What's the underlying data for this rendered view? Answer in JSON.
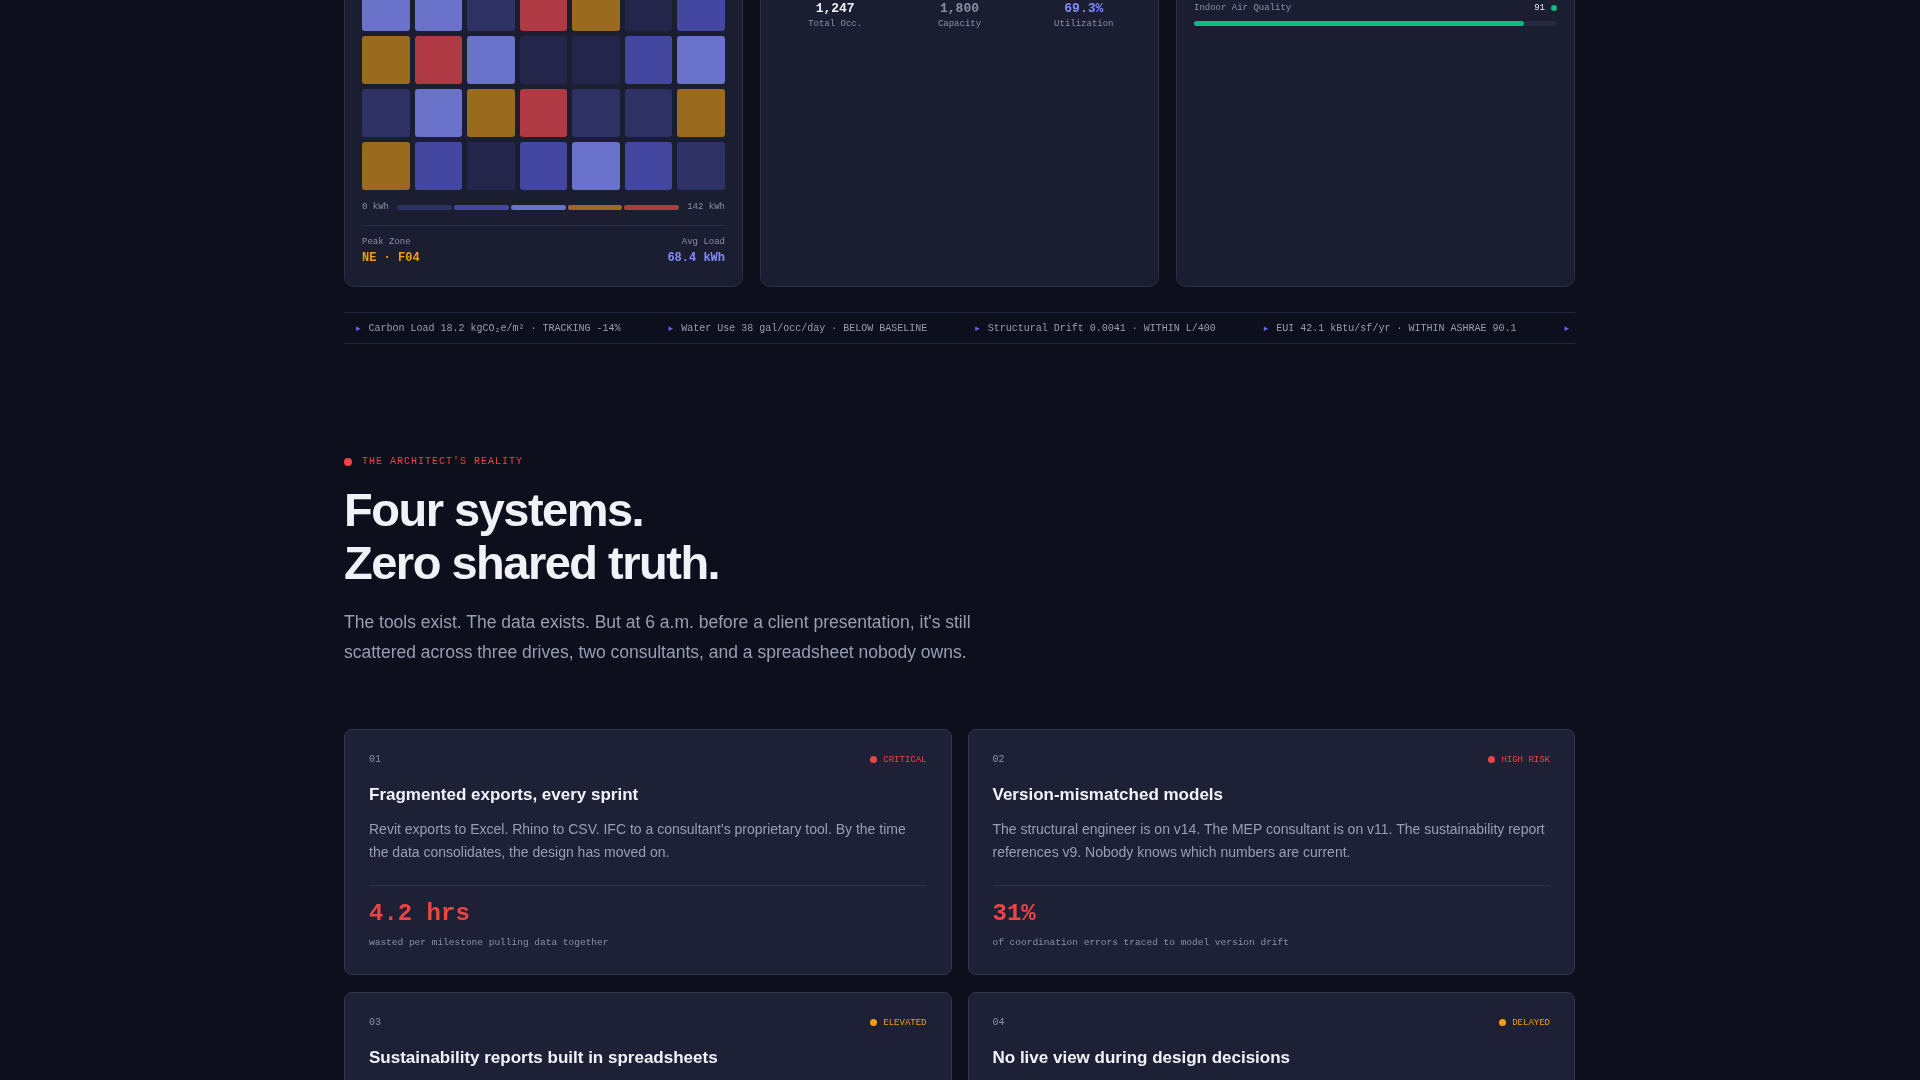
{
  "heatmap": {
    "cells": [
      {
        "color": "#6b72c9"
      },
      {
        "color": "#6b72c9"
      },
      {
        "color": "#2e3163"
      },
      {
        "color": "#b03a43"
      },
      {
        "color": "#9a6b1f"
      },
      {
        "color": "#23264a"
      },
      {
        "color": "#4347a0"
      },
      {
        "color": "#9a6b1f"
      },
      {
        "color": "#b03a43"
      },
      {
        "color": "#6b72c9"
      },
      {
        "color": "#23264a"
      },
      {
        "color": "#23264a"
      },
      {
        "color": "#4347a0"
      },
      {
        "color": "#6b72c9"
      },
      {
        "color": "#2e3163"
      },
      {
        "color": "#6b72c9"
      },
      {
        "color": "#9a6b1f"
      },
      {
        "color": "#b03a43"
      },
      {
        "color": "#2e3163"
      },
      {
        "color": "#2e3163"
      },
      {
        "color": "#9a6b1f"
      },
      {
        "color": "#9a6b1f"
      },
      {
        "color": "#4347a0"
      },
      {
        "color": "#23264a"
      },
      {
        "color": "#4347a0"
      },
      {
        "color": "#6b72c9"
      },
      {
        "color": "#4347a0"
      },
      {
        "color": "#2e3163"
      }
    ],
    "legend": {
      "min": "0 kWh",
      "max": "142 kWh"
    },
    "footer": [
      {
        "label": "Peak Zone",
        "value": "NE · F04",
        "kind": "peak"
      },
      {
        "label": "Avg Load",
        "value": "68.4 kWh",
        "kind": "avg"
      }
    ]
  },
  "occupancy": {
    "stats": [
      {
        "value": "1,247",
        "label": "Total Occ.",
        "kind": "plain"
      },
      {
        "value": "1,800",
        "label": "Capacity",
        "kind": "muted"
      },
      {
        "value": "69.3%",
        "label": "Utilization",
        "kind": "accent"
      }
    ]
  },
  "environment": {
    "metrics": [
      {
        "label": "Indoor Air Quality",
        "reading": "91",
        "level": 0.91,
        "color": "#10b981"
      }
    ]
  },
  "ticker": {
    "items": [
      {
        "marker": "▸",
        "text": "Carbon Load 18.2 kgCO₂e/m² · TRACKING -14%"
      },
      {
        "marker": "▸",
        "text": "Water Use 38 gal/occ/day · BELOW BASELINE"
      },
      {
        "marker": "▸",
        "text": "Structural Drift 0.0041 · WITHIN L/400"
      },
      {
        "marker": "▸",
        "text": "EUI 42.1 kBtu/sf/yr · WITHIN ASHRAE 90.1"
      }
    ],
    "trailing_marker": "▸"
  },
  "section": {
    "eyebrow": "THE ARCHITECT'S REALITY",
    "heading_lines": [
      "Four systems.",
      "Zero shared truth."
    ],
    "intro": "The tools exist. The data exists. But at 6 a.m. before a client presentation, it's still scattered across three drives, two consultants, and a spreadsheet nobody owns."
  },
  "cards": [
    {
      "number": "01",
      "status": "CRITICAL",
      "color": "#ef4444",
      "title": "Fragmented exports, every sprint",
      "body": "Revit exports to Excel. Rhino to CSV. IFC to a consultant's proprietary tool. By the time the data consolidates, the design has moved on.",
      "stat": "4.2 hrs",
      "caption": "wasted per milestone pulling data together"
    },
    {
      "number": "02",
      "status": "HIGH RISK",
      "color": "#ef4444",
      "title": "Version-mismatched models",
      "body": "The structural engineer is on v14. The MEP consultant is on v11. The sustainability report references v9. Nobody knows which numbers are current.",
      "stat": "31%",
      "caption": "of coordination errors traced to model version drift"
    },
    {
      "number": "03",
      "status": "ELEVATED",
      "color": "#f59e0b",
      "title": "Sustainability reports built in spreadsheets"
    },
    {
      "number": "04",
      "status": "DELAYED",
      "color": "#f59e0b",
      "title": "No live view during design decisions"
    }
  ]
}
